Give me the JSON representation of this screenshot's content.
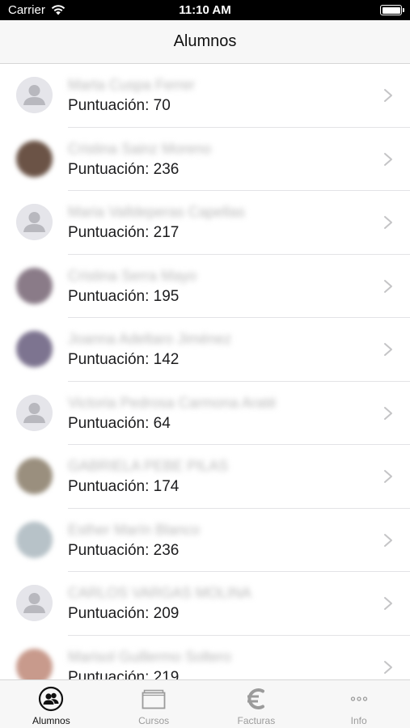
{
  "status_bar": {
    "carrier": "Carrier",
    "time": "11:10 AM"
  },
  "nav": {
    "title": "Alumnos"
  },
  "students": [
    {
      "name": "Marta Cuspa Ferrer",
      "score_label": "Puntuación: 70",
      "avatar": "placeholder",
      "photo_color": ""
    },
    {
      "name": "Cristina Sainz Moreno",
      "score_label": "Puntuación: 236",
      "avatar": "photo",
      "photo_color": "#6b5346"
    },
    {
      "name": "Maria Valldeperas Capellas",
      "score_label": "Puntuación: 217",
      "avatar": "placeholder",
      "photo_color": ""
    },
    {
      "name": "Cristina Serra Mayo",
      "score_label": "Puntuación: 195",
      "avatar": "photo",
      "photo_color": "#8a7b88"
    },
    {
      "name": "Joanna Adeltaro Jiménez",
      "score_label": "Puntuación: 142",
      "avatar": "photo",
      "photo_color": "#7d7490"
    },
    {
      "name": "Victoria Pedrosa Carmona Araté",
      "score_label": "Puntuación: 64",
      "avatar": "placeholder",
      "photo_color": ""
    },
    {
      "name": "GABRIELA PEBE PILAS",
      "score_label": "Puntuación: 174",
      "avatar": "photo",
      "photo_color": "#9a8f7e"
    },
    {
      "name": "Esther Marín Blanco",
      "score_label": "Puntuación: 236",
      "avatar": "photo",
      "photo_color": "#b7c2c8"
    },
    {
      "name": "CARLOS VARGAS MOLINA",
      "score_label": "Puntuación: 209",
      "avatar": "placeholder",
      "photo_color": ""
    },
    {
      "name": "Marisol Guillermo Soltero",
      "score_label": "Puntuación: 219",
      "avatar": "photo",
      "photo_color": "#c89a8c"
    }
  ],
  "tabs": [
    {
      "label": "Alumnos",
      "icon": "users-icon",
      "active": true
    },
    {
      "label": "Cursos",
      "icon": "courses-icon",
      "active": false
    },
    {
      "label": "Facturas",
      "icon": "euro-icon",
      "active": false
    },
    {
      "label": "Info",
      "icon": "more-icon",
      "active": false
    }
  ],
  "colors": {
    "active_tab": "#111111",
    "inactive_tab": "#9b9b9b",
    "chevron": "#c4c4c6"
  }
}
